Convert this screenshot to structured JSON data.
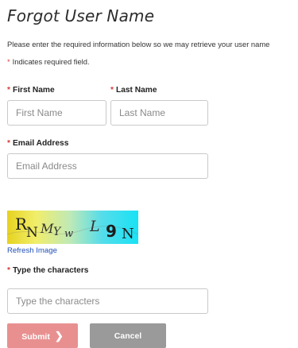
{
  "page": {
    "title": "Forgot User Name",
    "intro": "Please enter the required information below so we may retrieve your user name",
    "required_note": "Indicates required field.",
    "asterisk": "*"
  },
  "form": {
    "first_name": {
      "label": "First Name",
      "placeholder": "First Name",
      "value": ""
    },
    "last_name": {
      "label": "Last Name",
      "placeholder": "Last Name",
      "value": ""
    },
    "email": {
      "label": "Email Address",
      "placeholder": "Email Address",
      "value": ""
    },
    "captcha": {
      "chars": [
        "R",
        "N",
        "M",
        "Y",
        "w",
        "L",
        "9",
        "N"
      ],
      "refresh_label": "Refresh Image",
      "label": "Type the characters",
      "placeholder": "Type the characters",
      "value": ""
    }
  },
  "buttons": {
    "submit_label": "Submit",
    "submit_icon": "chevron-right-icon",
    "cancel_label": "Cancel"
  },
  "colors": {
    "required": "#d83b3b",
    "submit_bg": "#e89090",
    "cancel_bg": "#9a9a9a",
    "link": "#1f4fb8"
  }
}
